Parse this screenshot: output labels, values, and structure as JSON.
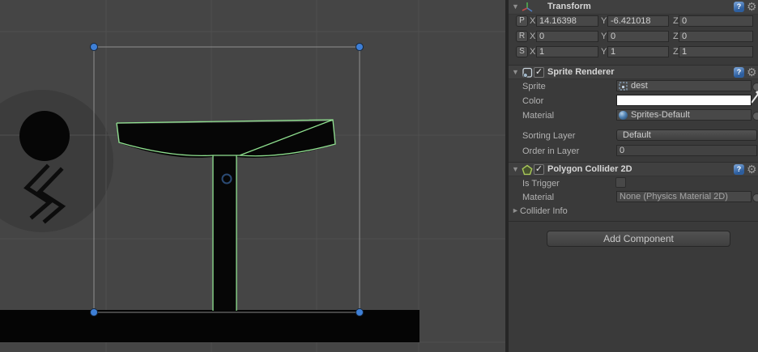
{
  "scene": {
    "colors": {
      "background": "#454545",
      "grid_line": "#505050",
      "sprite_black": "#060606",
      "collider_green": "#8fe08f",
      "selection_line": "#9b9b9b",
      "handle_blue": "#3e7fd6",
      "pivot_ring_blue": "#2b4a73",
      "ghost_circle_gray": "#3c3c3c"
    }
  },
  "icons": {
    "foldout_open": "▼",
    "foldout_closed": "►",
    "gear": "⚙",
    "help": "?",
    "checkmark": "✓"
  },
  "inspector": {
    "transform": {
      "title": "Transform",
      "rows": [
        {
          "btn": "P",
          "xl": "X",
          "x": "14.16398",
          "yl": "Y",
          "y": "-6.421018",
          "zl": "Z",
          "z": "0"
        },
        {
          "btn": "R",
          "xl": "X",
          "x": "0",
          "yl": "Y",
          "y": "0",
          "zl": "Z",
          "z": "0"
        },
        {
          "btn": "S",
          "xl": "X",
          "x": "1",
          "yl": "Y",
          "y": "1",
          "zl": "Z",
          "z": "1"
        }
      ]
    },
    "sprite_renderer": {
      "title": "Sprite Renderer",
      "sprite_label": "Sprite",
      "sprite_value": "dest",
      "color_label": "Color",
      "material_label": "Material",
      "material_value": "Sprites-Default",
      "sorting_layer_label": "Sorting Layer",
      "sorting_layer_value": "Default",
      "order_label": "Order in Layer",
      "order_value": "0"
    },
    "polygon_collider": {
      "title": "Polygon Collider 2D",
      "is_trigger_label": "Is Trigger",
      "material_label": "Material",
      "material_value": "None (Physics Material 2D)",
      "collider_info_label": "Collider Info"
    },
    "add_component_label": "Add Component"
  }
}
